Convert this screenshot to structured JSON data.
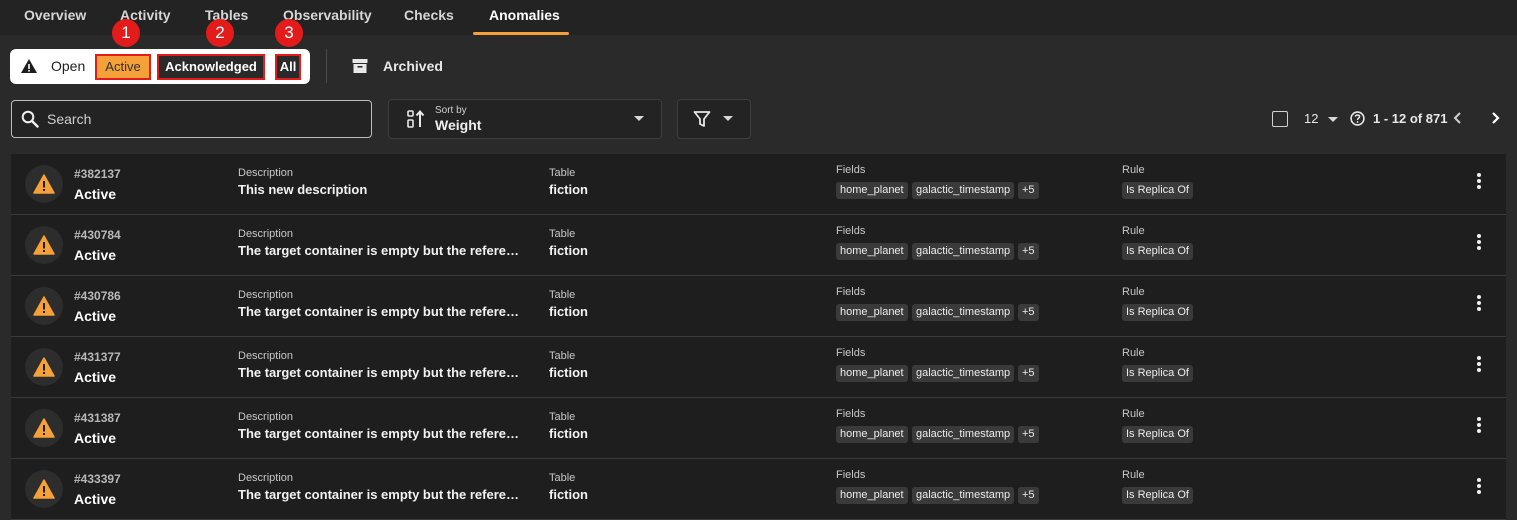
{
  "tabs": [
    "Overview",
    "Activity",
    "Tables",
    "Observability",
    "Checks",
    "Anomalies"
  ],
  "active_tab": "Anomalies",
  "status_filter": {
    "open_label": "Open",
    "active_label": "Active",
    "acknowledged_label": "Acknowledged",
    "all_label": "All",
    "archived_label": "Archived"
  },
  "callouts": [
    "1",
    "2",
    "3"
  ],
  "search": {
    "placeholder": "Search"
  },
  "sort": {
    "caption": "Sort by",
    "value": "Weight"
  },
  "pagination": {
    "page_size": "12",
    "range": "1 - 12 of 871"
  },
  "columns": {
    "description": "Description",
    "table": "Table",
    "fields": "Fields",
    "rule": "Rule"
  },
  "rows": [
    {
      "id": "#382137",
      "status": "Active",
      "description": "This new description",
      "table": "fiction",
      "fields": [
        "home_planet",
        "galactic_timestamp"
      ],
      "more_fields": "+5",
      "rule": "Is Replica Of"
    },
    {
      "id": "#430784",
      "status": "Active",
      "description": "The target container is empty but the reference container is not",
      "table": "fiction",
      "fields": [
        "home_planet",
        "galactic_timestamp"
      ],
      "more_fields": "+5",
      "rule": "Is Replica Of"
    },
    {
      "id": "#430786",
      "status": "Active",
      "description": "The target container is empty but the reference container is not",
      "table": "fiction",
      "fields": [
        "home_planet",
        "galactic_timestamp"
      ],
      "more_fields": "+5",
      "rule": "Is Replica Of"
    },
    {
      "id": "#431377",
      "status": "Active",
      "description": "The target container is empty but the reference container is not",
      "table": "fiction",
      "fields": [
        "home_planet",
        "galactic_timestamp"
      ],
      "more_fields": "+5",
      "rule": "Is Replica Of"
    },
    {
      "id": "#431387",
      "status": "Active",
      "description": "The target container is empty but the reference container is not",
      "table": "fiction",
      "fields": [
        "home_planet",
        "galactic_timestamp"
      ],
      "more_fields": "+5",
      "rule": "Is Replica Of"
    },
    {
      "id": "#433397",
      "status": "Active",
      "description": "The target container is empty but the reference container is not",
      "table": "fiction",
      "fields": [
        "home_planet",
        "galactic_timestamp"
      ],
      "more_fields": "+5",
      "rule": "Is Replica Of"
    }
  ],
  "colors": {
    "accent": "#f5a039",
    "highlight": "#e31b1b",
    "background": "#2a2a2a",
    "row": "#1e1e1e"
  }
}
